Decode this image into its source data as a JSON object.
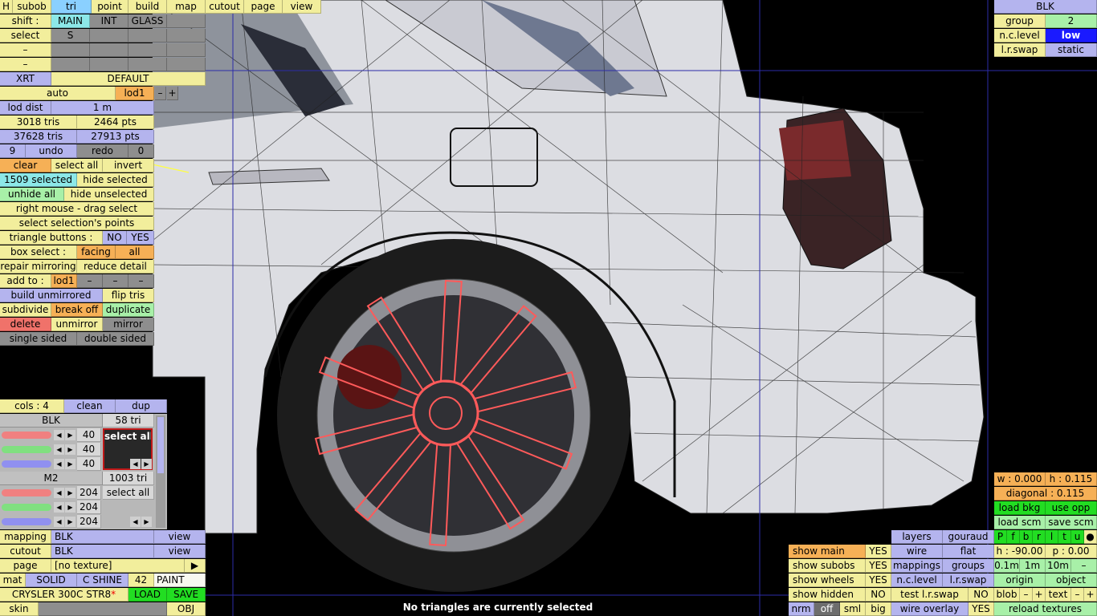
{
  "top_menu": {
    "h": "H",
    "subob": "subob",
    "tri": "tri",
    "point": "point",
    "build": "build",
    "map": "map",
    "cutout": "cutout",
    "page": "page",
    "view": "view"
  },
  "left_panel": {
    "shift_label": "shift :",
    "shift_main": "MAIN",
    "shift_int": "INT",
    "shift_glass": "GLASS",
    "select_label": "select",
    "select_s": "S",
    "dash": "–",
    "xrt": "XRT",
    "default": "DEFAULT",
    "auto": "auto",
    "lod1": "lod1",
    "minus": "–",
    "plus": "+",
    "lod_dist": "lod dist",
    "lod_dist_value": "1 m",
    "tris_1": "3018 tris",
    "pts_1": "2464 pts",
    "tris_2": "37628 tris",
    "pts_2": "27913 pts",
    "undo_count": "9",
    "undo": "undo",
    "redo": "redo",
    "redo_count": "0",
    "clear": "clear",
    "select_all": "select all",
    "invert": "invert",
    "selected_count": "1509 selected",
    "hide_selected": "hide selected",
    "unhide_all": "unhide all",
    "hide_unselected": "hide unselected",
    "right_mouse": "right mouse - drag select",
    "select_selection_points": "select selection's points",
    "triangle_buttons": "triangle buttons :",
    "no": "NO",
    "yes": "YES",
    "box_select": "box select :",
    "facing": "facing",
    "all": "all",
    "repair_mirroring": "repair mirroring",
    "reduce_detail": "reduce detail",
    "add_to": "add to :",
    "add_to_lod": "lod1",
    "build_unmirrored": "build unmirrored",
    "flip_tris": "flip tris",
    "subdivide": "subdivide",
    "break_off": "break off",
    "duplicate": "duplicate",
    "delete": "delete",
    "unmirror": "unmirror",
    "mirror": "mirror",
    "single_sided": "single sided",
    "double_sided": "double sided"
  },
  "colors_panel": {
    "cols": "cols : 4",
    "clean": "clean",
    "dup": "dup",
    "mat1_name": "BLK",
    "mat1_tri": "58 tri",
    "mat1_values": [
      "40",
      "40",
      "40"
    ],
    "mat1_select": "select all",
    "mat2_name": "M2",
    "mat2_tri": "1003 tri",
    "mat2_values": [
      "204",
      "204",
      "204"
    ],
    "mat2_select": "select all"
  },
  "bottom_left": {
    "mapping": "mapping",
    "mapping_value": "BLK",
    "view": "view",
    "cutout": "cutout",
    "cutout_value": "BLK",
    "page": "page",
    "page_value": "[no texture]",
    "page_arrow": "▶",
    "mat": "mat",
    "solid": "SOLID",
    "c_shine": "C SHINE",
    "shine_value": "42",
    "paint": "PAINT",
    "car_name": "CRYSLER 300C STR8",
    "car_mark": "*",
    "load": "LOAD",
    "save": "SAVE",
    "skin": "skin",
    "obj": "OBJ"
  },
  "top_right": {
    "blk": "BLK",
    "group": "group",
    "group_value": "2",
    "nc_level": "n.c.level",
    "nc_value": "low",
    "lr_swap": "l.r.swap",
    "lr_value": "static"
  },
  "bottom_right": {
    "show_main": "show main",
    "show_main_v": "YES",
    "show_subobs": "show subobs",
    "show_subobs_v": "YES",
    "show_wheels": "show wheels",
    "show_wheels_v": "YES",
    "show_hidden": "show hidden",
    "show_hidden_v": "NO",
    "nrm": "nrm",
    "off": "off",
    "sml": "sml",
    "big": "big",
    "layers": "layers",
    "gouraud": "gouraud",
    "wire": "wire",
    "flat": "flat",
    "mappings": "mappings",
    "groups": "groups",
    "n_c_level": "n.c.level",
    "l_r_swap": "l.r.swap",
    "test_lr_swap": "test l.r.swap",
    "test_v": "NO",
    "wire_overlay": "wire overlay",
    "wire_overlay_v": "YES",
    "w": "w : 0.000",
    "h": "h : 0.115",
    "diagonal": "diagonal : 0.115",
    "load_bkg": "load bkg",
    "use_opp": "use opp",
    "load_scm": "load scm",
    "save_scm": "save scm",
    "letters": [
      "P",
      "f",
      "b",
      "r",
      "l",
      "t",
      "u",
      "●"
    ],
    "heading": "h : -90.00",
    "pitch": "p : 0.00",
    "step1": "0.1m",
    "step2": "1m",
    "step3": "10m",
    "step_minus": "–",
    "origin": "origin",
    "object": "object",
    "blob": "blob",
    "text": "text",
    "reload_textures": "reload textures"
  },
  "status": "No triangles are currently selected"
}
